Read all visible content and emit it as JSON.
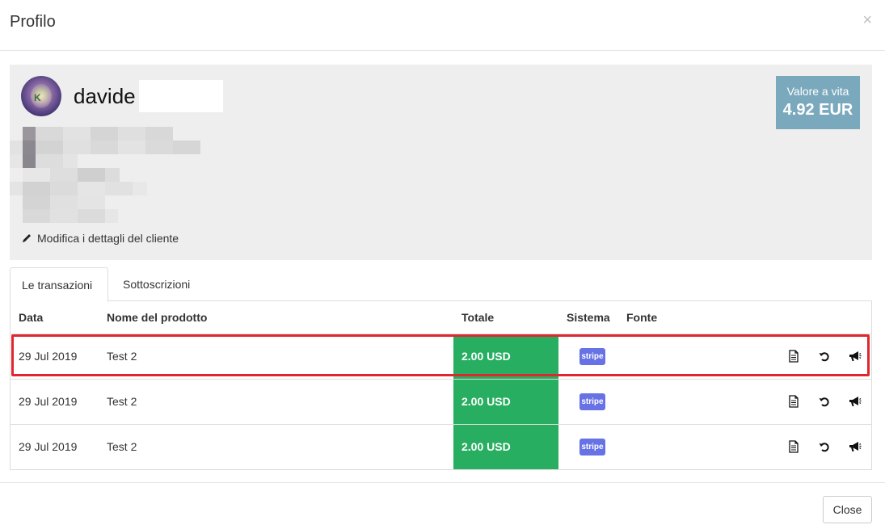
{
  "modal": {
    "title": "Profilo",
    "close_symbol": "×"
  },
  "profile": {
    "username": "davide",
    "edit_link_label": "Modifica i dettagli del cliente",
    "edit_icon": "pencil-icon",
    "lifetime_label": "Valore a vita",
    "lifetime_value": "4.92 EUR",
    "lifetime_color": "#7aa8bd"
  },
  "tabs": [
    {
      "label": "Le transazioni",
      "active": true
    },
    {
      "label": "Sottoscrizioni",
      "active": false
    }
  ],
  "table": {
    "headers": {
      "date": "Data",
      "product": "Nome del prodotto",
      "total": "Totale",
      "system": "Sistema",
      "source": "Fonte"
    },
    "rows": [
      {
        "date": "29 Jul 2019",
        "product": "Test 2",
        "total": "2.00 USD",
        "system": "stripe",
        "highlighted": true
      },
      {
        "date": "29 Jul 2019",
        "product": "Test 2",
        "total": "2.00 USD",
        "system": "stripe",
        "highlighted": false
      },
      {
        "date": "29 Jul 2019",
        "product": "Test 2",
        "total": "2.00 USD",
        "system": "stripe",
        "highlighted": false
      }
    ],
    "row_actions": [
      "invoice-icon",
      "refund-icon",
      "megaphone-icon"
    ],
    "total_color": "#27ae60",
    "stripe_color": "#6772e5"
  },
  "highlight_color": "#e0262e",
  "footer": {
    "close_label": "Close"
  }
}
